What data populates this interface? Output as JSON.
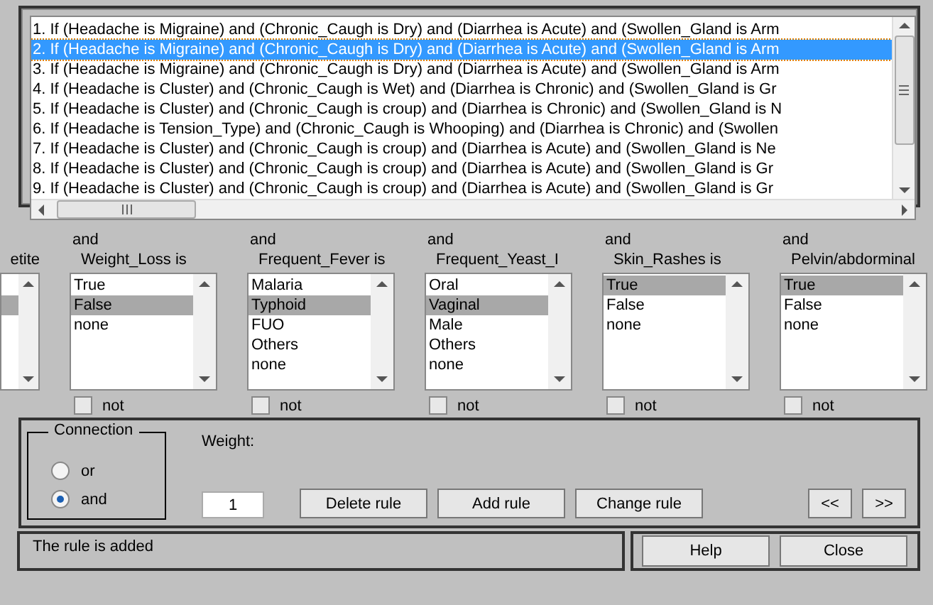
{
  "rules": [
    {
      "text": "1. If (Headache is Migraine) and (Chronic_Caugh is Dry) and (Diarrhea is Acute) and (Swollen_Gland is Arm",
      "selected": false
    },
    {
      "text": "2. If (Headache is Migraine) and (Chronic_Caugh is Dry) and (Diarrhea is Acute) and (Swollen_Gland is Arm",
      "selected": true
    },
    {
      "text": "3. If (Headache is Migraine) and (Chronic_Caugh is Dry) and (Diarrhea is Acute) and (Swollen_Gland is Arm",
      "selected": false
    },
    {
      "text": "4. If (Headache is Cluster) and (Chronic_Caugh is Wet) and (Diarrhea is Chronic) and (Swollen_Gland is Gr",
      "selected": false
    },
    {
      "text": "5. If (Headache is Cluster) and (Chronic_Caugh is croup) and (Diarrhea is Chronic) and (Swollen_Gland is N",
      "selected": false
    },
    {
      "text": "6. If (Headache is Tension_Type) and (Chronic_Caugh is Whooping) and (Diarrhea is Chronic) and (Swollen",
      "selected": false
    },
    {
      "text": "7. If (Headache is Cluster) and (Chronic_Caugh is croup) and (Diarrhea is Acute) and (Swollen_Gland is Ne",
      "selected": false
    },
    {
      "text": "8. If (Headache is Cluster) and (Chronic_Caugh is croup) and (Diarrhea is Acute) and (Swollen_Gland is Gr",
      "selected": false
    },
    {
      "text": "9. If (Headache is Cluster) and (Chronic_Caugh is croup) and (Diarrhea is Acute) and (Swollen_Gland is Gr",
      "selected": false
    }
  ],
  "conditions": [
    {
      "kind": "partial",
      "label": "etite",
      "options": [
        {
          "selected": false
        },
        {
          "selected": true
        }
      ]
    },
    {
      "kind": "full",
      "connector": "and",
      "label": "Weight_Loss is",
      "options": [
        {
          "text": "True",
          "selected": false
        },
        {
          "text": "False",
          "selected": true
        },
        {
          "text": "none",
          "selected": false
        }
      ],
      "not_label": "not",
      "negated": false
    },
    {
      "kind": "full",
      "connector": "and",
      "label": "Frequent_Fever is",
      "options": [
        {
          "text": "Malaria",
          "selected": false
        },
        {
          "text": "Typhoid",
          "selected": true
        },
        {
          "text": "FUO",
          "selected": false
        },
        {
          "text": "Others",
          "selected": false
        },
        {
          "text": "none",
          "selected": false
        }
      ],
      "not_label": "not",
      "negated": false
    },
    {
      "kind": "full",
      "connector": "and",
      "label": "Frequent_Yeast_I",
      "options": [
        {
          "text": "Oral",
          "selected": false
        },
        {
          "text": "Vaginal",
          "selected": true
        },
        {
          "text": "Male",
          "selected": false
        },
        {
          "text": "Others",
          "selected": false
        },
        {
          "text": "none",
          "selected": false
        }
      ],
      "not_label": "not",
      "negated": false
    },
    {
      "kind": "full",
      "connector": "and",
      "label": "Skin_Rashes is",
      "options": [
        {
          "text": "True",
          "selected": true
        },
        {
          "text": "False",
          "selected": false
        },
        {
          "text": "none",
          "selected": false
        }
      ],
      "not_label": "not",
      "negated": false
    },
    {
      "kind": "full",
      "connector": "and",
      "label": "Pelvin/abdorminal",
      "options": [
        {
          "text": "True",
          "selected": true
        },
        {
          "text": "False",
          "selected": false
        },
        {
          "text": "none",
          "selected": false
        }
      ],
      "not_label": "not",
      "negated": false
    }
  ],
  "connection": {
    "title": "Connection",
    "options": [
      {
        "label": "or",
        "selected": false
      },
      {
        "label": "and",
        "selected": true
      }
    ]
  },
  "weight": {
    "label": "Weight:",
    "value": "1"
  },
  "rule_buttons": [
    "Delete rule",
    "Add rule",
    "Change rule"
  ],
  "nav_buttons": [
    "<<",
    ">>"
  ],
  "status": "The rule is added",
  "dialog_buttons": [
    "Help",
    "Close"
  ]
}
